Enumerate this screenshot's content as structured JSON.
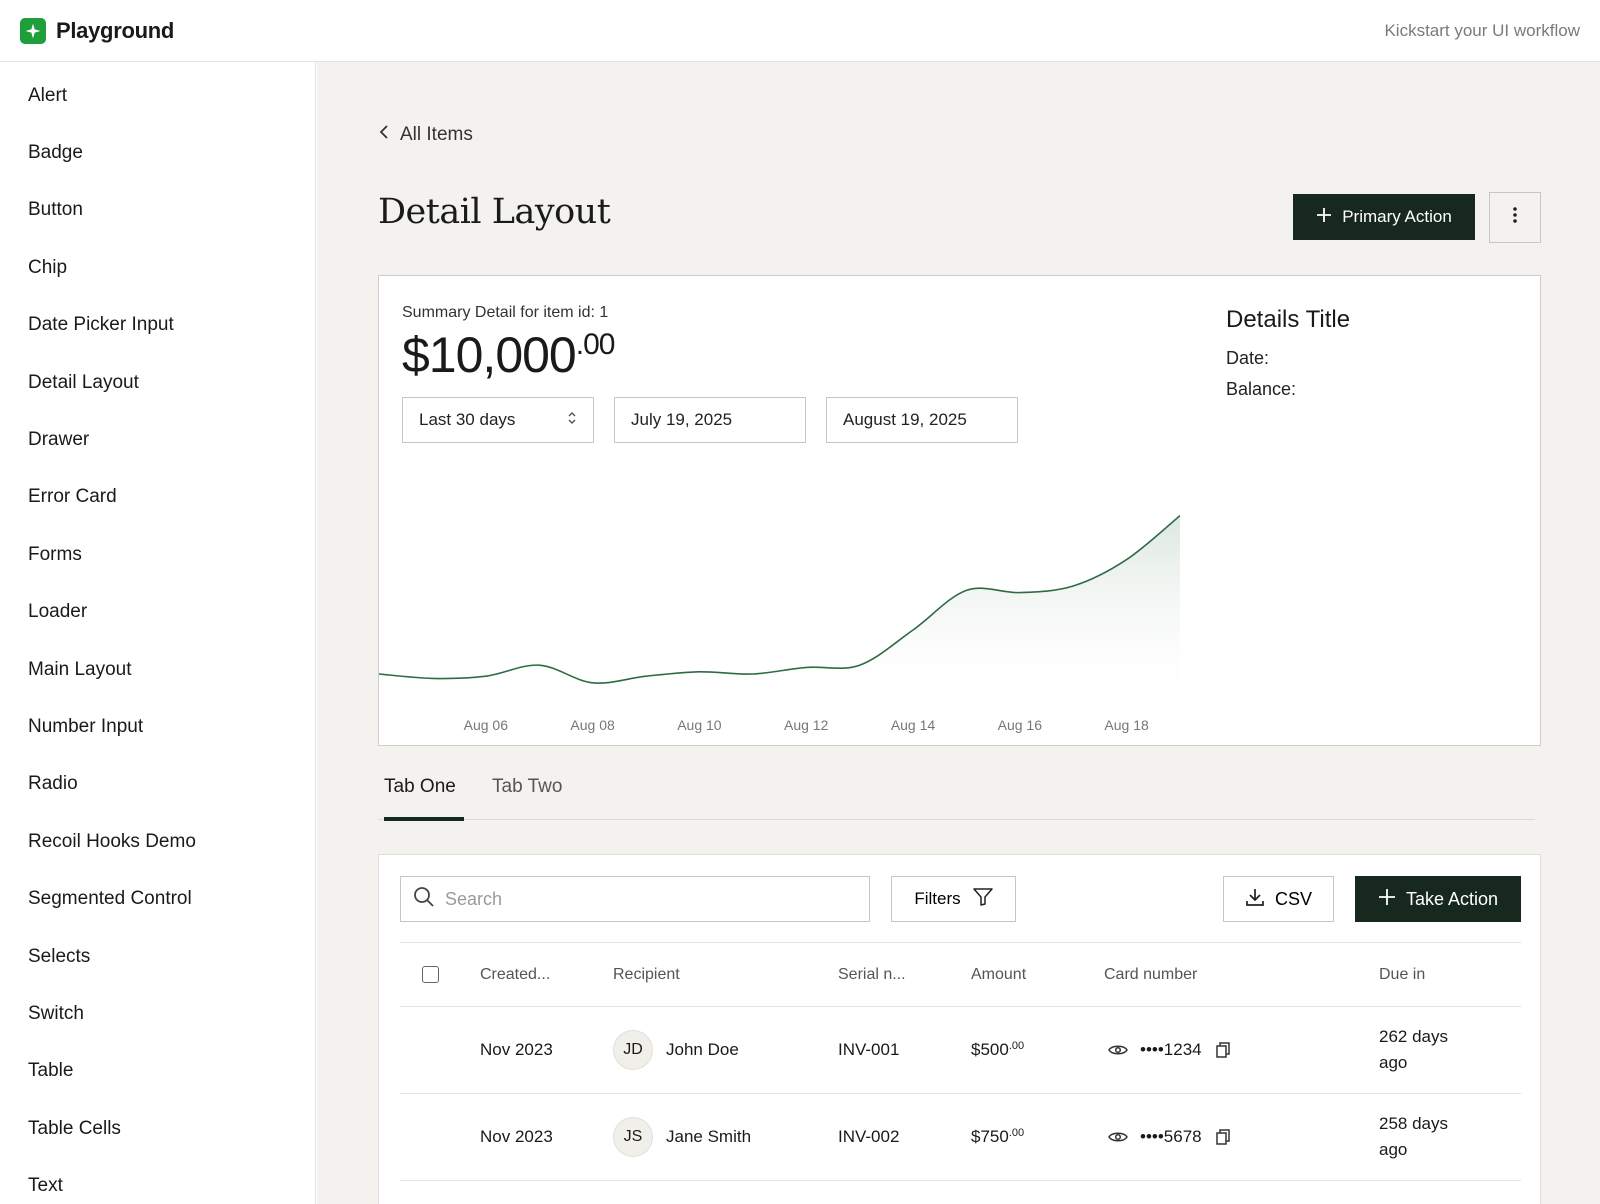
{
  "header": {
    "app_name": "Playground",
    "tagline": "Kickstart your UI workflow"
  },
  "sidebar": {
    "items": [
      {
        "label": "Alert"
      },
      {
        "label": "Badge"
      },
      {
        "label": "Button"
      },
      {
        "label": "Chip"
      },
      {
        "label": "Date Picker Input"
      },
      {
        "label": "Detail Layout"
      },
      {
        "label": "Drawer"
      },
      {
        "label": "Error Card"
      },
      {
        "label": "Forms"
      },
      {
        "label": "Loader"
      },
      {
        "label": "Main Layout"
      },
      {
        "label": "Number Input"
      },
      {
        "label": "Radio"
      },
      {
        "label": "Recoil Hooks Demo"
      },
      {
        "label": "Segmented Control"
      },
      {
        "label": "Selects"
      },
      {
        "label": "Switch"
      },
      {
        "label": "Table"
      },
      {
        "label": "Table Cells"
      },
      {
        "label": "Text"
      }
    ]
  },
  "breadcrumb": {
    "label": "All Items"
  },
  "page": {
    "title": "Detail Layout",
    "primary_action_label": "Primary Action"
  },
  "summary": {
    "label": "Summary Detail for item id: 1",
    "amount_main": "$10,000",
    "amount_cents": ".00",
    "range_select": "Last 30 days",
    "start_date": "July 19, 2025",
    "end_date": "August 19, 2025"
  },
  "details": {
    "title": "Details Title",
    "date_label": "Date:",
    "balance_label": "Balance:"
  },
  "chart_data": {
    "type": "area",
    "x_ticks": [
      "Aug 06",
      "Aug 08",
      "Aug 10",
      "Aug 12",
      "Aug 14",
      "Aug 16",
      "Aug 18"
    ],
    "x": [
      "Aug 04",
      "Aug 05",
      "Aug 06",
      "Aug 07",
      "Aug 08",
      "Aug 09",
      "Aug 10",
      "Aug 11",
      "Aug 12",
      "Aug 13",
      "Aug 14",
      "Aug 15",
      "Aug 16",
      "Aug 17",
      "Aug 18",
      "Aug 19"
    ],
    "values": [
      10,
      8,
      9,
      14,
      6,
      9,
      11,
      10,
      13,
      14,
      30,
      48,
      47,
      50,
      62,
      82
    ],
    "ylim": [
      0,
      100
    ],
    "line_color": "#2f6b45",
    "fill_color": "#e3ebe5"
  },
  "tabs": [
    {
      "label": "Tab One",
      "active": true
    },
    {
      "label": "Tab Two",
      "active": false
    }
  ],
  "toolbar": {
    "search_placeholder": "Search",
    "filters_label": "Filters",
    "csv_label": "CSV",
    "take_action_label": "Take Action"
  },
  "table": {
    "columns": [
      "Created...",
      "Recipient",
      "Serial n...",
      "Amount",
      "Card number",
      "Due in"
    ],
    "rows": [
      {
        "created": "Nov 2023",
        "initials": "JD",
        "recipient": "John Doe",
        "serial": "INV-001",
        "amount": "$500",
        "amount_cents": ".00",
        "card": "••••1234",
        "due_line1": "262 days",
        "due_line2": "ago"
      },
      {
        "created": "Nov 2023",
        "initials": "JS",
        "recipient": "Jane Smith",
        "serial": "INV-002",
        "amount": "$750",
        "amount_cents": ".00",
        "card": "••••5678",
        "due_line1": "258 days",
        "due_line2": "ago"
      }
    ]
  },
  "colors": {
    "brand": "#1f9e3a",
    "primary_button": "#17281f",
    "main_background": "#f4f2ee"
  }
}
